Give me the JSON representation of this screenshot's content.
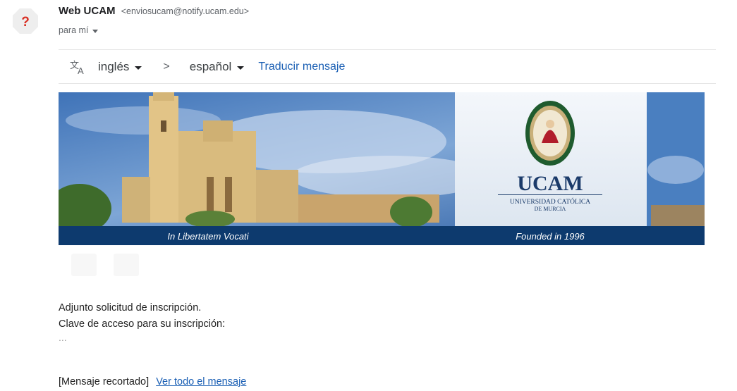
{
  "sender": {
    "name": "Web UCAM",
    "email": "<enviosucam@notify.ucam.edu>"
  },
  "recipient": {
    "label": "para mí"
  },
  "avatar": {
    "glyph": "?",
    "color": "#d93025"
  },
  "translation": {
    "source_lang": "inglés",
    "arrow": ">",
    "target_lang": "español",
    "action_label": "Traducir mensaje"
  },
  "banner": {
    "left_caption": "In Libertatem Vocati",
    "right_caption": "Founded in 1996",
    "logo_title": "UCAM",
    "logo_sub1": "UNIVERSIDAD CATÓLICA",
    "logo_sub2": "DE MURCIA",
    "band_color": "#0d3a6e"
  },
  "message": {
    "line1": "Adjunto solicitud de inscripción.",
    "line2": "Clave de acceso para su inscripción:",
    "ellipsis": "...",
    "trimmed_label": "[Mensaje recortado]",
    "view_all_link": "Ver todo el mensaje"
  }
}
